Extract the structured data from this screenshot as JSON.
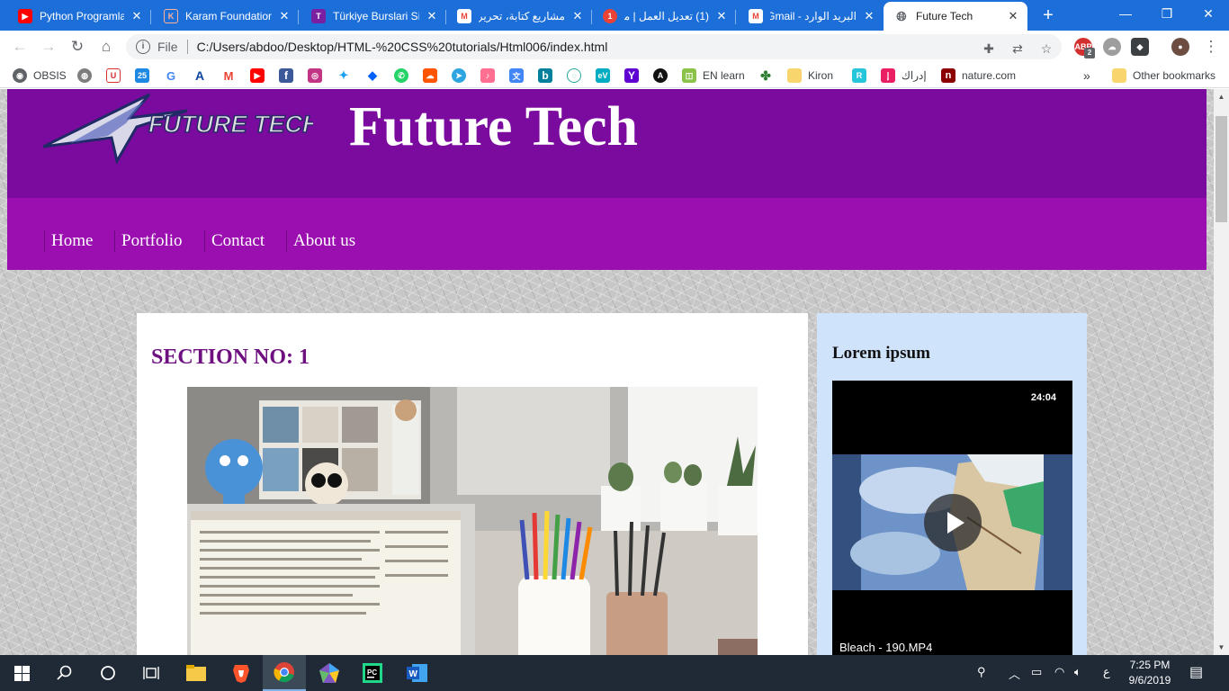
{
  "browser": {
    "tabs": [
      {
        "title": "Python Programla",
        "icon": "youtube-icon",
        "color": "#ff0000"
      },
      {
        "title": "Karam Foundation",
        "icon": "karam-icon",
        "color": "#e8542b"
      },
      {
        "title": "Türkiye Burslari Sis",
        "icon": "turkiye-burslari-icon",
        "color": "#7b1fa2"
      },
      {
        "title": "مشاريع كتابة، تحرير",
        "icon": "gmail-icon",
        "color": "#ea4335"
      },
      {
        "title": "(1) تعديل العمل | مد",
        "icon": "notification-icon",
        "color": "#ea4335"
      },
      {
        "title": "البريد الوارد - Gmail",
        "icon": "gmail-icon",
        "color": "#ea4335"
      },
      {
        "title": "Future Tech",
        "icon": "globe-icon",
        "color": "#5f6368"
      }
    ],
    "new_tab": "+",
    "window_controls": {
      "minimize": "—",
      "maximize": "❐",
      "close": "✕"
    },
    "address": {
      "scheme": "File",
      "url": "C:/Users/abdoo/Desktop/HTML-%20CSS%20tutorials/Html006/index.html"
    },
    "extension_badge": "2",
    "bookmarks": [
      {
        "label": "OBSIS",
        "icon": "obsis-icon",
        "color": "#5f6368"
      },
      {
        "label": "",
        "icon": "earth-icon",
        "color": "#7d7d7d"
      },
      {
        "label": "",
        "icon": "shield-icon",
        "color": "#d32f2f"
      },
      {
        "label": "",
        "icon": "calendar-icon",
        "color": "#1e88e5"
      },
      {
        "label": "",
        "icon": "google-icon",
        "color": "#4285f4"
      },
      {
        "label": "",
        "icon": "a-icon",
        "color": "#0d47a1"
      },
      {
        "label": "",
        "icon": "gmail-icon",
        "color": "#ea4335"
      },
      {
        "label": "",
        "icon": "youtube-icon",
        "color": "#ff0000"
      },
      {
        "label": "",
        "icon": "facebook-icon",
        "color": "#3b5998"
      },
      {
        "label": "",
        "icon": "instagram-icon",
        "color": "#c13584"
      },
      {
        "label": "",
        "icon": "twitter-icon",
        "color": "#1da1f2"
      },
      {
        "label": "",
        "icon": "dropbox-icon",
        "color": "#0061ff"
      },
      {
        "label": "",
        "icon": "whatsapp-icon",
        "color": "#25d366"
      },
      {
        "label": "",
        "icon": "soundcloud-icon",
        "color": "#ff5500"
      },
      {
        "label": "",
        "icon": "telegram-icon",
        "color": "#2ca5e0"
      },
      {
        "label": "",
        "icon": "music-icon",
        "color": "#ff6f91"
      },
      {
        "label": "",
        "icon": "translate-icon",
        "color": "#4285f4"
      },
      {
        "label": "",
        "icon": "bing-icon",
        "color": "#00809d"
      },
      {
        "label": "",
        "icon": "circle-icon",
        "color": "#26a69a"
      },
      {
        "label": "",
        "icon": "ev-icon",
        "color": "#00acc1"
      },
      {
        "label": "",
        "icon": "yahoo-icon",
        "color": "#5f01d1"
      },
      {
        "label": "",
        "icon": "dark-circle-icon",
        "color": "#111111"
      },
      {
        "label": "EN learn",
        "icon": "en-learn-icon",
        "color": "#8bc34a"
      },
      {
        "label": "",
        "icon": "clover-icon",
        "color": "#2e7d32"
      },
      {
        "label": "Kiron",
        "icon": "folder-icon",
        "color": "#f9d56e"
      },
      {
        "label": "",
        "icon": "r-icon",
        "color": "#26c6da"
      },
      {
        "label": "إدراك",
        "icon": "edraak-icon",
        "color": "#e91e63"
      },
      {
        "label": "nature.com",
        "icon": "nature-icon",
        "color": "#8b0000"
      }
    ],
    "overflow": "»",
    "other_bookmarks": "Other bookmarks"
  },
  "site": {
    "logo_text": "FUTURE TECH",
    "title": "Future Tech",
    "nav": [
      "Home",
      "Portfolio",
      "Contact",
      "About us"
    ],
    "section_title": "SECTION NO: 1",
    "sidebar_title": "Lorem ipsum",
    "video": {
      "duration": "24:04",
      "name": "Bleach - 190.MP4"
    }
  },
  "taskbar": {
    "clock_time": "7:25 PM",
    "clock_date": "9/6/2019",
    "language": "ع"
  },
  "colors": {
    "header": "#7b0a9e",
    "nav": "#9b0fb0",
    "section_title": "#6e1080",
    "sidebar": "#cfe4fb"
  }
}
